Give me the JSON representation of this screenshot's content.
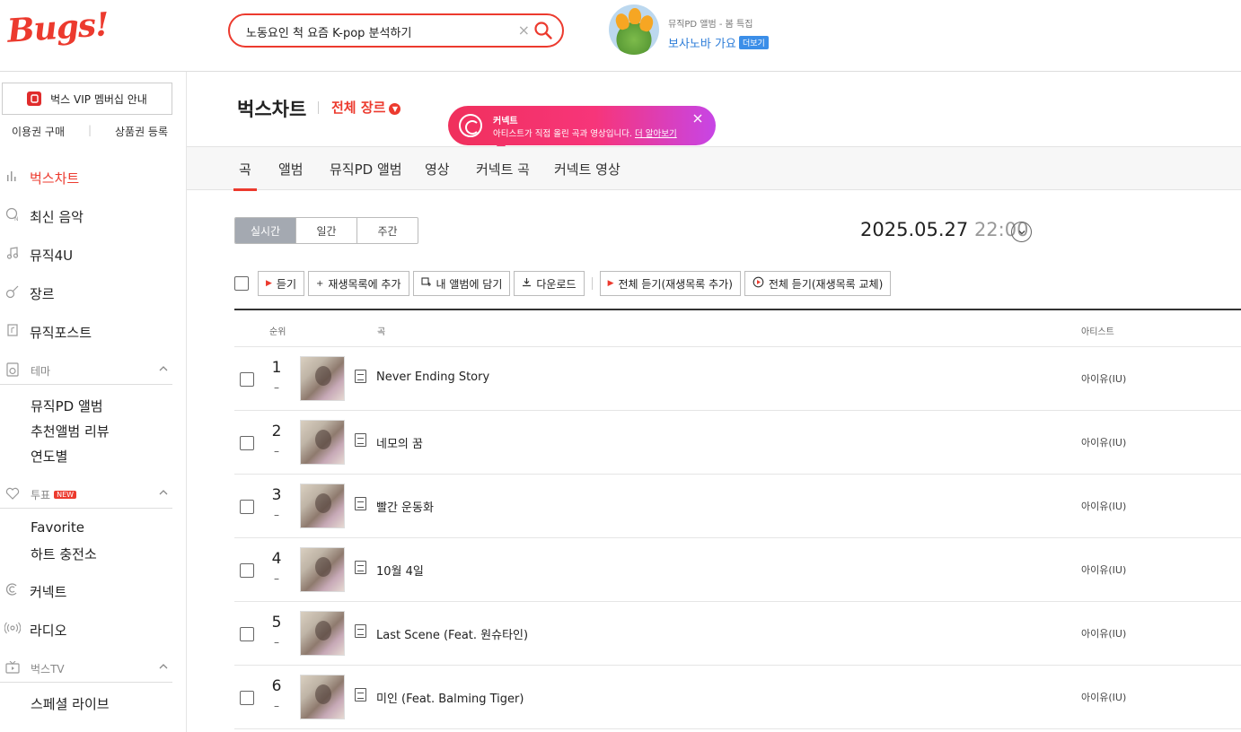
{
  "header": {
    "logo": "Bugs!",
    "search_query": "노동요인 척 요즘 K-pop 분석하기",
    "clear_symbol": "×",
    "promo": {
      "subtitle": "뮤직PD 앨범 - 봄 특집",
      "title": "보사노바 가요",
      "more_label": "더보기"
    }
  },
  "sidebar": {
    "vip_label": "벅스 VIP 멤버십 안내",
    "links": [
      "이용권 구매",
      "상품권 등록"
    ],
    "link_sep": "|",
    "nav": [
      {
        "label": "벅스차트",
        "icon": "chart-bars-icon",
        "active": true
      },
      {
        "label": "최신 음악",
        "icon": "new-music-icon"
      },
      {
        "label": "뮤직4U",
        "icon": "music-note-icon"
      },
      {
        "label": "장르",
        "icon": "guitar-icon"
      },
      {
        "label": "뮤직포스트",
        "icon": "music-post-icon"
      }
    ],
    "groups": {
      "theme": {
        "label": "테마",
        "icon": "speaker-icon",
        "items": [
          "뮤직PD 앨범",
          "추천앨범 리뷰",
          "연도별"
        ]
      },
      "vote": {
        "label": "투표",
        "badge": "NEW",
        "icon": "heart-icon",
        "items": [
          "Favorite",
          "하트 충전소"
        ]
      },
      "connect": {
        "label": "커넥트",
        "icon": "connect-icon"
      },
      "radio": {
        "label": "라디오",
        "icon": "radio-icon"
      },
      "bugstv": {
        "label": "벅스TV",
        "icon": "tv-icon",
        "items": [
          "스페셜 라이브"
        ]
      }
    }
  },
  "main": {
    "title": "벅스차트",
    "genre_label": "전체 장르",
    "connect_tip": {
      "title": "커넥트",
      "body": "아티스트가 직접 올린 곡과 영상입니다.",
      "link": "더 알아보기"
    },
    "tabs": [
      "곡",
      "앨범",
      "뮤직PD 앨범",
      "영상",
      "커넥트 곡",
      "커넥트 영상"
    ],
    "periods": [
      "실시간",
      "일간",
      "주간"
    ],
    "date": "2025.05.27",
    "time": "22:00",
    "actions": {
      "play": "듣기",
      "add_playlist": "재생목록에 추가",
      "add_album": "내 앨범에 담기",
      "download": "다운로드",
      "play_all_add": "전체 듣기(재생목록 추가)",
      "play_all_replace": "전체 듣기(재생목록 교체)"
    },
    "columns": {
      "rank": "순위",
      "song": "곡",
      "artist": "아티스트"
    },
    "rows": [
      {
        "rank": "1",
        "change": "–",
        "title": "Never Ending Story",
        "artist": "아이유(IU)"
      },
      {
        "rank": "2",
        "change": "–",
        "title": "네모의 꿈",
        "artist": "아이유(IU)"
      },
      {
        "rank": "3",
        "change": "–",
        "title": "빨간 운동화",
        "artist": "아이유(IU)"
      },
      {
        "rank": "4",
        "change": "–",
        "title": "10월 4일",
        "artist": "아이유(IU)"
      },
      {
        "rank": "5",
        "change": "–",
        "title": "Last Scene (Feat. 원슈타인)",
        "artist": "아이유(IU)"
      },
      {
        "rank": "6",
        "change": "–",
        "title": "미인 (Feat. Balming Tiger)",
        "artist": "아이유(IU)"
      }
    ]
  },
  "colors": {
    "accent": "#ec3a2e",
    "link": "#2e7dd8",
    "tab_bg": "#f7f7f7"
  }
}
